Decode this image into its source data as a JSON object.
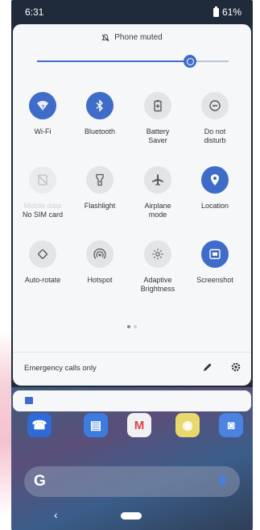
{
  "status_bar": {
    "time": "6:31",
    "battery": "61%"
  },
  "quick_settings": {
    "notice": "Phone muted",
    "volume_level": 0.8,
    "tiles": [
      {
        "id": "wifi",
        "label": "Wi-Fi",
        "sub": "",
        "state": "on",
        "icon": "wifi-icon"
      },
      {
        "id": "bluetooth",
        "label": "Bluetooth",
        "sub": "",
        "state": "on",
        "icon": "bluetooth-icon"
      },
      {
        "id": "battery-saver",
        "label": "Battery",
        "sub": "Saver",
        "state": "off",
        "icon": "battery-saver-icon"
      },
      {
        "id": "dnd",
        "label": "Do not",
        "sub": "disturb",
        "state": "off",
        "icon": "do-not-disturb-icon"
      },
      {
        "id": "mobile-data",
        "label": "Mobile data",
        "sub": "No SIM card",
        "state": "disabled",
        "icon": "mobile-data-icon"
      },
      {
        "id": "flashlight",
        "label": "Flashlight",
        "sub": "",
        "state": "off",
        "icon": "flashlight-icon"
      },
      {
        "id": "airplane",
        "label": "Airplane",
        "sub": "mode",
        "state": "off",
        "icon": "airplane-icon"
      },
      {
        "id": "location",
        "label": "Location",
        "sub": "",
        "state": "on",
        "icon": "location-icon"
      },
      {
        "id": "auto-rotate",
        "label": "Auto-rotate",
        "sub": "",
        "state": "off",
        "icon": "auto-rotate-icon"
      },
      {
        "id": "hotspot",
        "label": "Hotspot",
        "sub": "",
        "state": "off",
        "icon": "hotspot-icon"
      },
      {
        "id": "adaptive-brightness",
        "label": "Adaptive",
        "sub": "Brightness",
        "state": "off",
        "icon": "adaptive-brightness-icon"
      },
      {
        "id": "screenshot",
        "label": "Screenshot",
        "sub": "",
        "state": "on",
        "icon": "screenshot-icon"
      }
    ],
    "page_dots": {
      "count": 2,
      "active": 0
    },
    "footer_status": "Emergency calls only"
  },
  "colors": {
    "accent": "#3f6cc9",
    "panel": "#f6f7f9",
    "tile_off": "#e3e4e7"
  }
}
